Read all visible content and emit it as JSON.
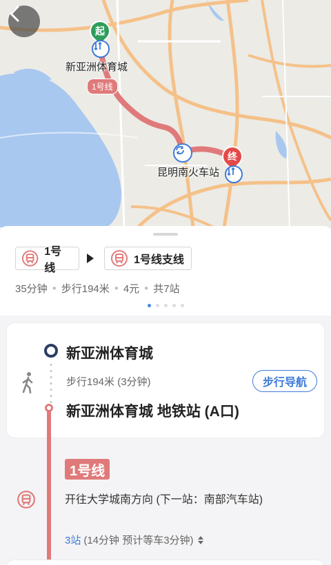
{
  "map": {
    "start_marker": "起",
    "end_marker": "终",
    "start_station": "新亚洲体育城",
    "end_station": "昆明南火车站",
    "route_tag": "1号线",
    "icons": [
      "back-arrow-icon",
      "metro-transfer-icon",
      "interchange-icon"
    ]
  },
  "route_summary": {
    "segments": [
      {
        "label": "1号线",
        "icon": "metro-icon"
      },
      {
        "label": "1号线支线",
        "icon": "metro-icon"
      }
    ],
    "duration": "35分钟",
    "walk": "步行194米",
    "fare": "4元",
    "stops_total": "共7站",
    "page_dots": 5,
    "active_dot": 0
  },
  "walk_step": {
    "start": "新亚洲体育城",
    "walk_info": "步行194米 (3分钟)",
    "nav_button": "步行导航",
    "destination": "新亚洲体育城 地铁站 (A口)"
  },
  "line_step": {
    "line_name": "1号线",
    "direction": "开往大学城南方向 (下一站：南部汽车站)",
    "stop_count": "3站",
    "stop_detail": "(14分钟 预计等车3分钟)"
  },
  "colors": {
    "line_red": "#e07a7a",
    "accent_blue": "#3f7ad8",
    "start_green": "#2e9e5b",
    "end_red": "#e54848"
  }
}
